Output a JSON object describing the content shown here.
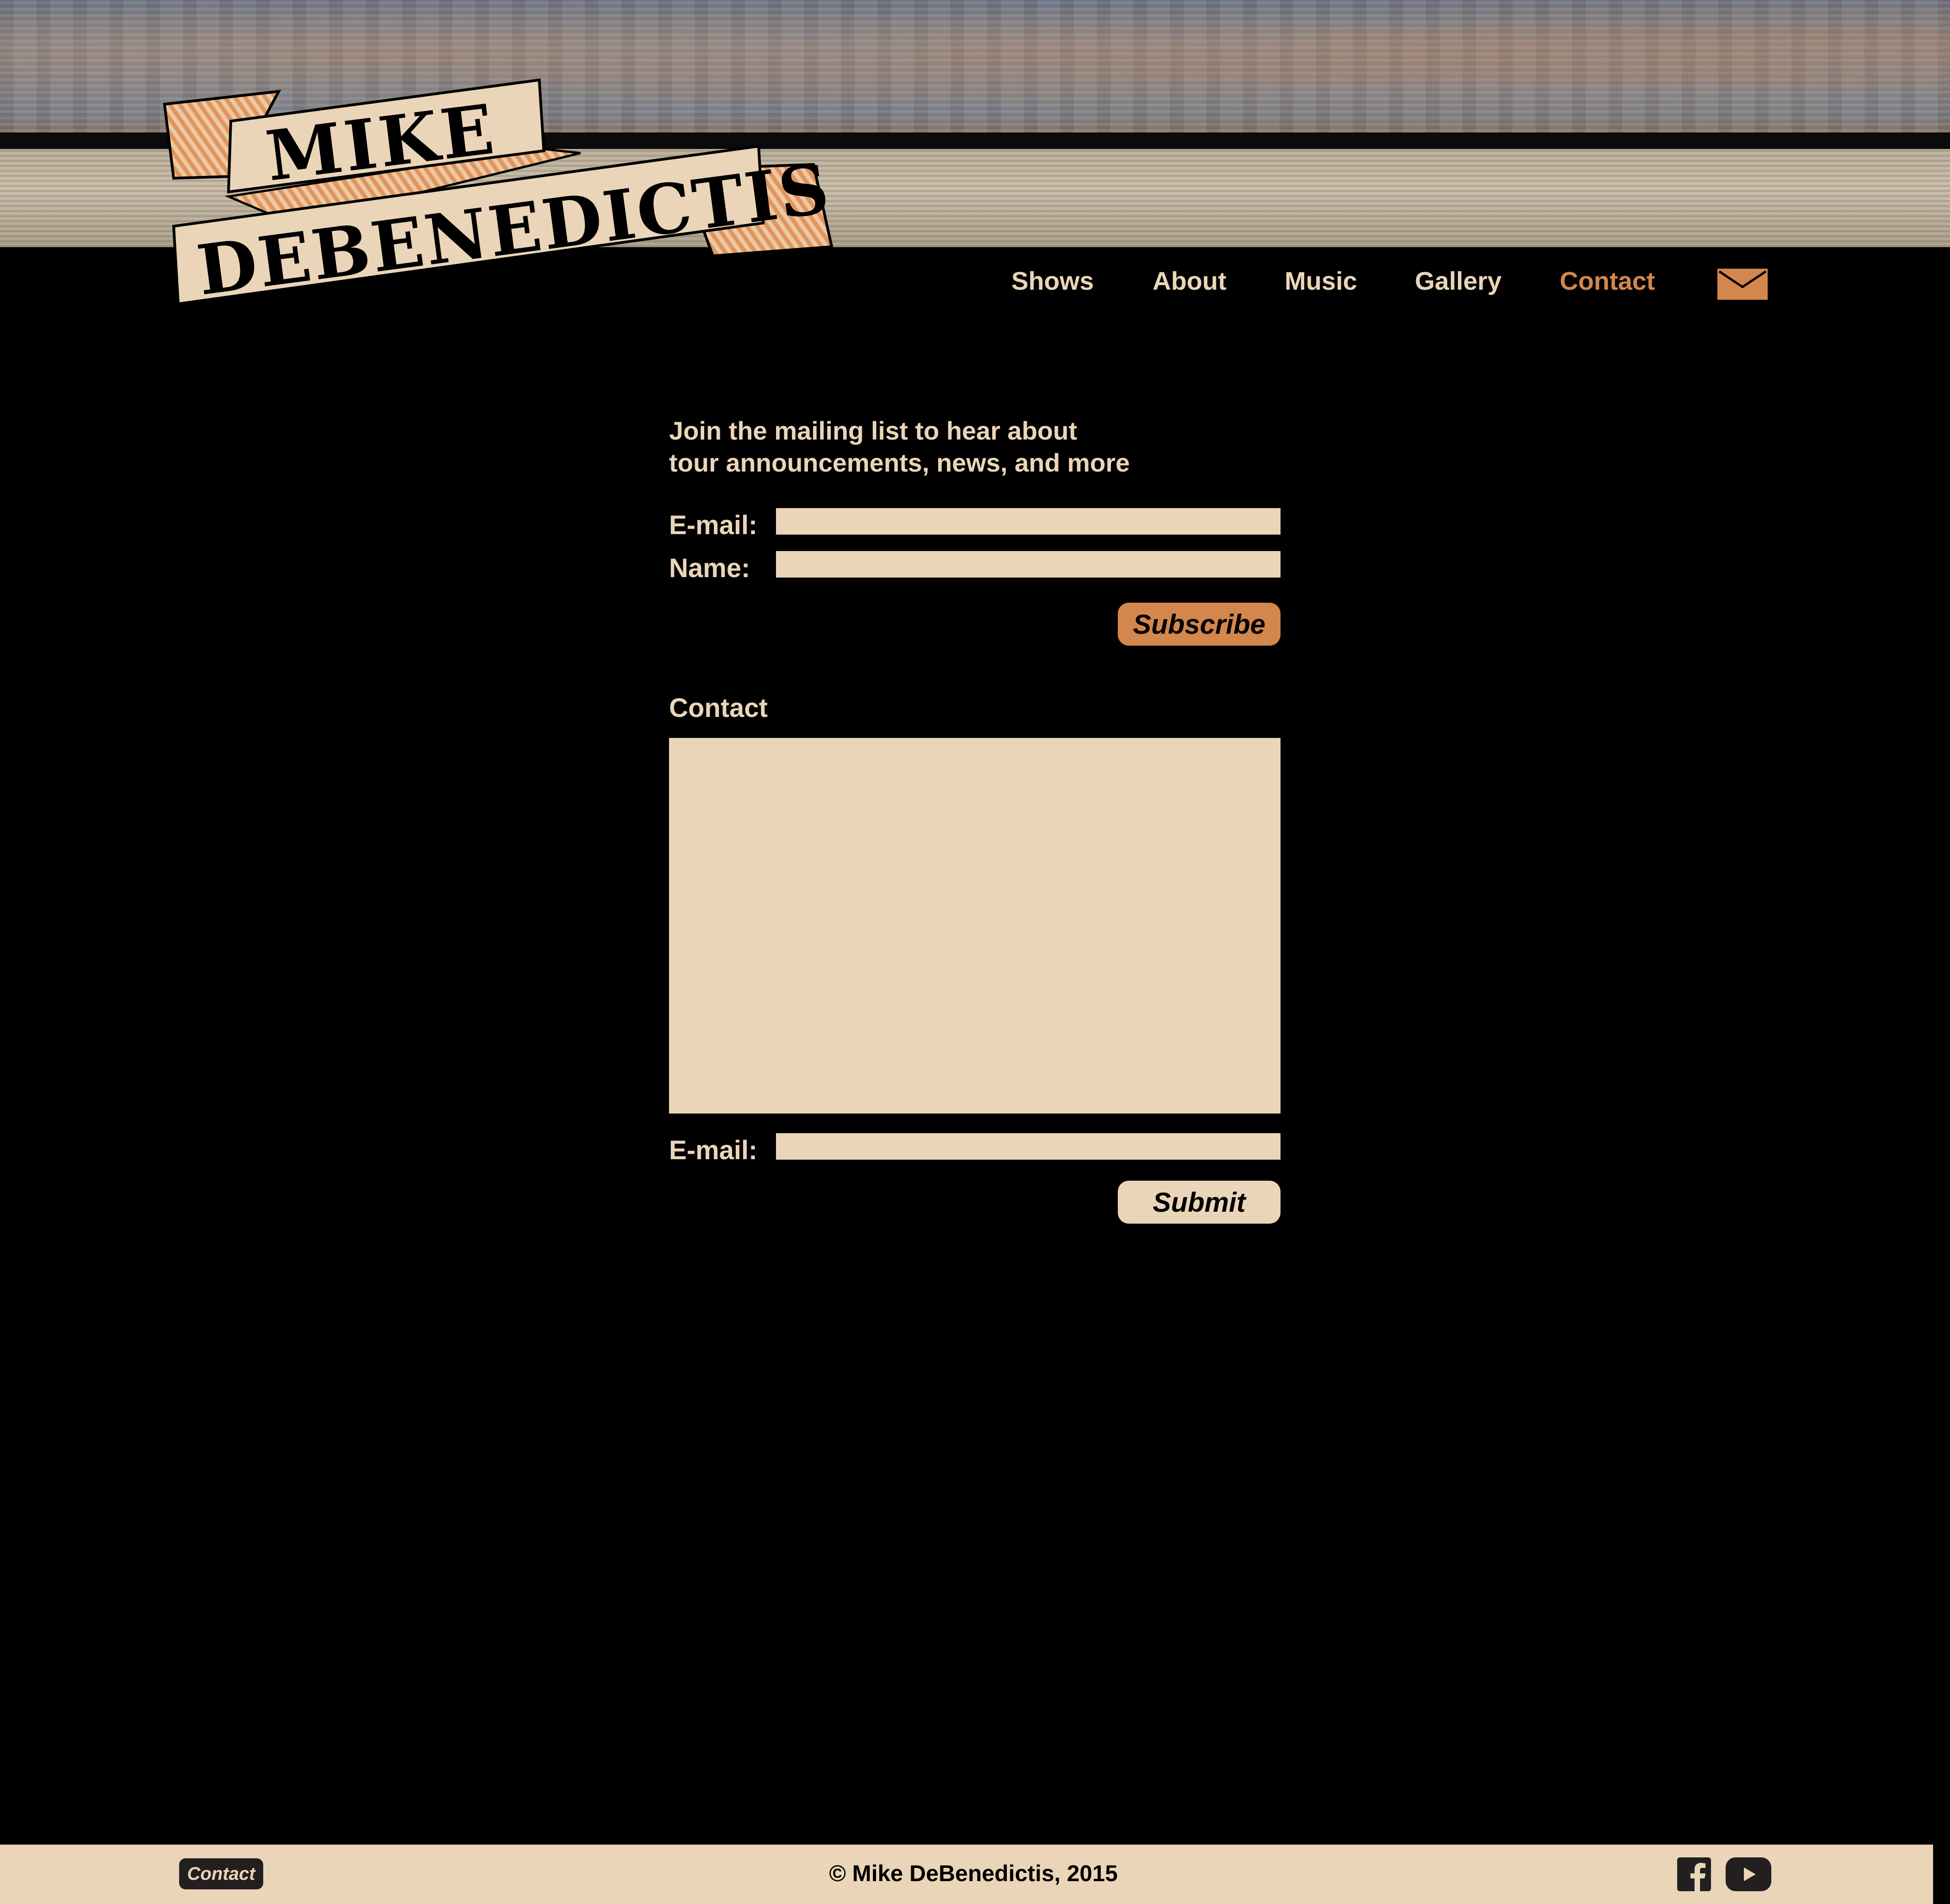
{
  "logo": {
    "line1": "MIKE",
    "line2": "DEBENEDICTIS"
  },
  "nav": {
    "items": [
      {
        "label": "Shows"
      },
      {
        "label": "About"
      },
      {
        "label": "Music"
      },
      {
        "label": "Gallery"
      },
      {
        "label": "Contact",
        "active": true
      }
    ],
    "mail_icon": "envelope-icon"
  },
  "mailing": {
    "intro_line1": "Join the mailing list to hear about",
    "intro_line2": "tour announcements, news, and more",
    "email_label": "E-mail:",
    "email_value": "",
    "name_label": "Name:",
    "name_value": "",
    "subscribe_label": "Subscribe"
  },
  "contact": {
    "heading": "Contact",
    "message_value": "",
    "email_label": "E-mail:",
    "email_value": "",
    "submit_label": "Submit"
  },
  "footer": {
    "contact_button": "Contact",
    "copyright": "© Mike DeBenedictis, 2015",
    "social_icons": [
      "facebook-icon",
      "youtube-icon"
    ]
  },
  "colors": {
    "accent": "#d4874c",
    "cream": "#ebd5b8",
    "background": "#000000",
    "footer_button": "#231f20"
  }
}
